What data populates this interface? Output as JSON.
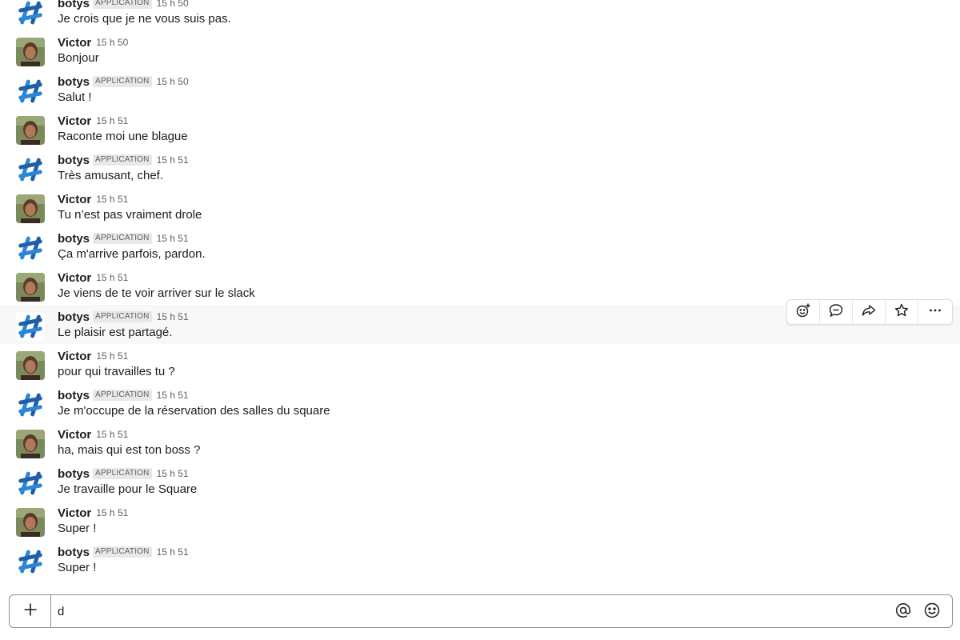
{
  "badge_label": "APPLICATION",
  "messages": [
    {
      "author": "botys",
      "is_app": true,
      "time": "15 h 50",
      "text": "Je crois que je ne vous suis pas."
    },
    {
      "author": "Victor",
      "is_app": false,
      "time": "15 h 50",
      "text": "Bonjour"
    },
    {
      "author": "botys",
      "is_app": true,
      "time": "15 h 50",
      "text": "Salut !"
    },
    {
      "author": "Victor",
      "is_app": false,
      "time": "15 h 51",
      "text": "Raconte moi une blague"
    },
    {
      "author": "botys",
      "is_app": true,
      "time": "15 h 51",
      "text": "Très amusant, chef."
    },
    {
      "author": "Victor",
      "is_app": false,
      "time": "15 h 51",
      "text": "Tu n’est pas vraiment drole"
    },
    {
      "author": "botys",
      "is_app": true,
      "time": "15 h 51",
      "text": "Ça m'arrive parfois, pardon."
    },
    {
      "author": "Victor",
      "is_app": false,
      "time": "15 h 51",
      "text": "Je viens de te voir arriver sur le slack"
    },
    {
      "author": "botys",
      "is_app": true,
      "time": "15 h 51",
      "text": "Le plaisir est partagé.",
      "hovered": true
    },
    {
      "author": "Victor",
      "is_app": false,
      "time": "15 h 51",
      "text": "pour qui travailles tu ?"
    },
    {
      "author": "botys",
      "is_app": true,
      "time": "15 h 51",
      "text": "Je m'occupe de la réservation des salles du square"
    },
    {
      "author": "Victor",
      "is_app": false,
      "time": "15 h 51",
      "text": "ha, mais qui est ton boss ?"
    },
    {
      "author": "botys",
      "is_app": true,
      "time": "15 h 51",
      "text": "Je travaille pour le Square"
    },
    {
      "author": "Victor",
      "is_app": false,
      "time": "15 h 51",
      "text": "Super !"
    },
    {
      "author": "botys",
      "is_app": true,
      "time": "15 h 51",
      "text": "Super !"
    }
  ],
  "hover_toolbar": {
    "actions": [
      {
        "name": "add-reaction",
        "icon": "add-reaction-icon"
      },
      {
        "name": "reply-in-thread",
        "icon": "comment-icon"
      },
      {
        "name": "share-message",
        "icon": "share-arrow-icon"
      },
      {
        "name": "star-message",
        "icon": "star-icon"
      },
      {
        "name": "more-actions",
        "icon": "more-horizontal-icon"
      }
    ]
  },
  "composer": {
    "value": "d",
    "icons": [
      "plus-icon",
      "at-mention-icon",
      "emoji-icon"
    ]
  },
  "colors": {
    "bot_avatar_blue": "#2b86d6",
    "bot_avatar_dark": "#1f5fa8",
    "victor_avatar_bg": "#7a8a5a",
    "hover_row_bg": "#f8f8f8",
    "badge_bg": "#e8e8e8"
  }
}
